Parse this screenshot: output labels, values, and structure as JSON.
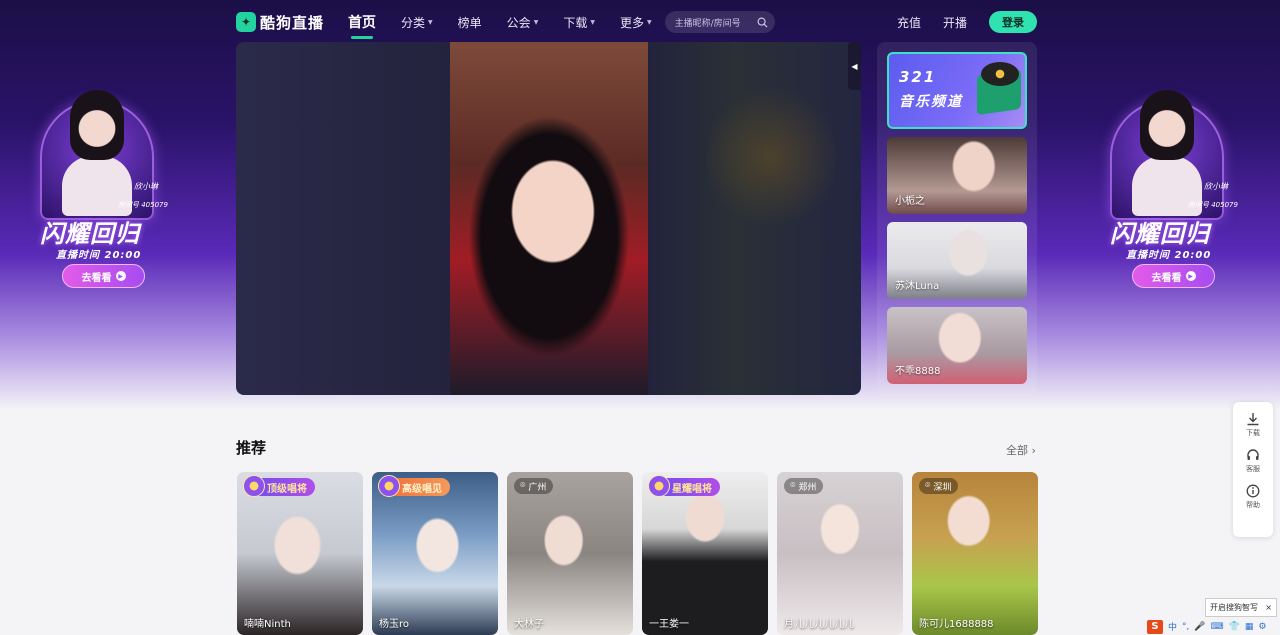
{
  "nav": {
    "logo_text": "酷狗直播",
    "items": [
      {
        "label": "首页",
        "active": true,
        "dropdown": false
      },
      {
        "label": "分类",
        "active": false,
        "dropdown": true
      },
      {
        "label": "榜单",
        "active": false,
        "dropdown": false
      },
      {
        "label": "公会",
        "active": false,
        "dropdown": true
      },
      {
        "label": "下载",
        "active": false,
        "dropdown": true
      },
      {
        "label": "更多",
        "active": false,
        "dropdown": true
      }
    ],
    "search_placeholder": "主播昵称/房间号",
    "recharge": "充值",
    "start_live": "开播",
    "login": "登录"
  },
  "promo": {
    "name": "欣小琳",
    "room": "房间号 405079",
    "headline": "闪耀回归",
    "time": "直播时间 20:00",
    "cta": "去看看"
  },
  "rail": {
    "music_line1": "321",
    "music_line2": "音乐频道",
    "streamers": [
      "小栀之",
      "苏沐Luna",
      "不乖8888"
    ]
  },
  "recommend": {
    "title": "推荐",
    "see_all": "全部",
    "cards": [
      {
        "name": "喃喃Ninth",
        "badge": "顶级唱将",
        "badge_style": "purple",
        "location": ""
      },
      {
        "name": "杨玉ro",
        "badge": "高级唱见",
        "badge_style": "orange",
        "location": ""
      },
      {
        "name": "大林子",
        "badge": "",
        "badge_style": "",
        "location": "广州"
      },
      {
        "name": "一王娄一",
        "badge": "星耀唱将",
        "badge_style": "purple",
        "location": ""
      },
      {
        "name": "月儿儿儿儿儿儿",
        "badge": "",
        "badge_style": "",
        "location": "郑州"
      },
      {
        "name": "陈可儿1688888",
        "badge": "",
        "badge_style": "",
        "location": "深圳"
      }
    ]
  },
  "tools": {
    "download": "下载",
    "service": "客服",
    "help": "帮助"
  },
  "ime": {
    "tip": "开启搜狗智写",
    "close": "×",
    "logo": "S",
    "mode": "中"
  },
  "colors": {
    "accent": "#2fe2b0",
    "hero_top": "#1b0f47",
    "hero_mid": "#5a2ab8"
  }
}
